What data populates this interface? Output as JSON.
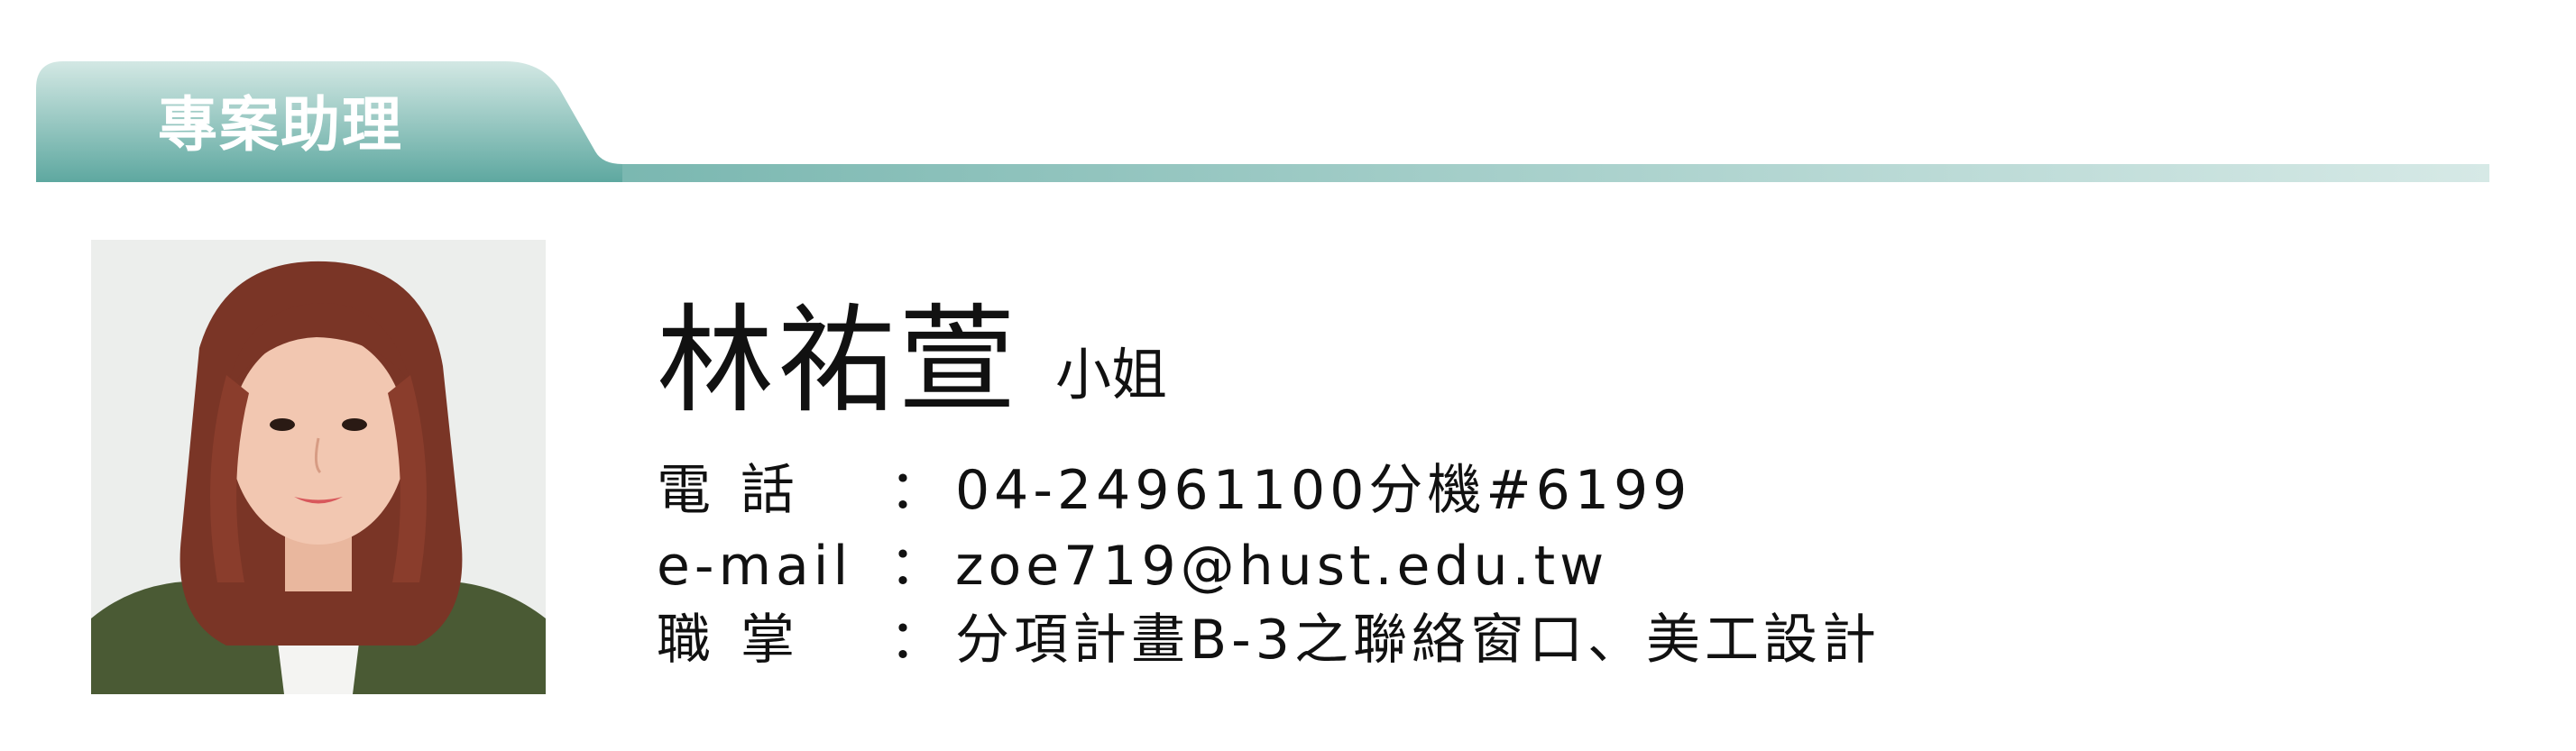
{
  "banner": {
    "title": "專案助理",
    "colors": {
      "dark": "#5ea8a0",
      "light": "#d6e9e6"
    }
  },
  "photo": {
    "alt": "portrait-photo"
  },
  "person": {
    "name": "林祐萱",
    "title": "小姐"
  },
  "info": {
    "phone": {
      "label_a": "電",
      "label_b": "話",
      "colon": "：",
      "value": "04-24961100分機#6199"
    },
    "email": {
      "label": "e-mail",
      "colon": "：",
      "value": "zoe719@hust.edu.tw"
    },
    "duty": {
      "label_a": "職",
      "label_b": "掌",
      "colon": "：",
      "value": "分項計畫B-3之聯絡窗口、美工設計"
    }
  }
}
